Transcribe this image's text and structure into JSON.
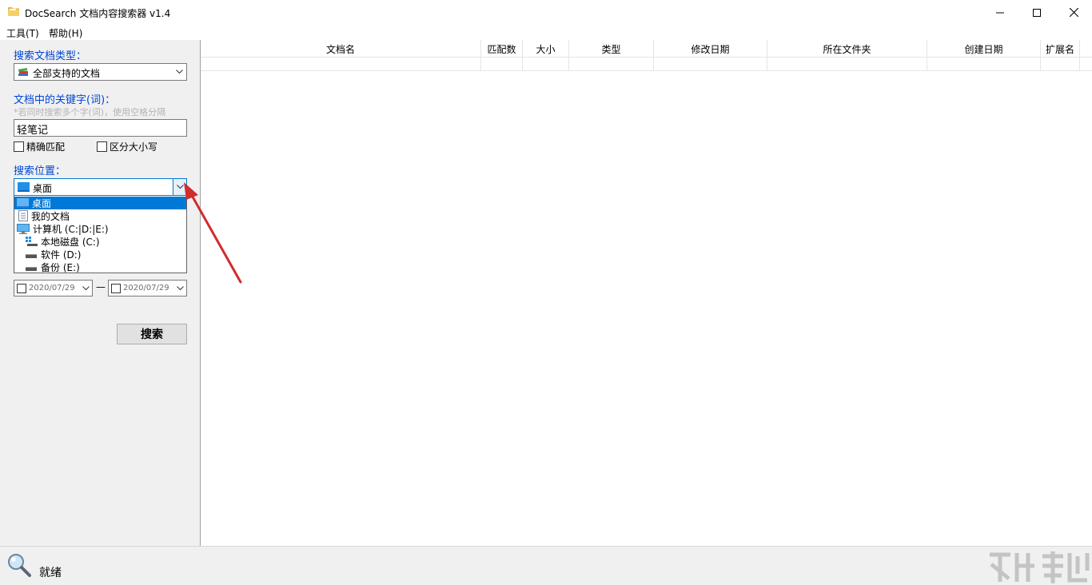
{
  "window": {
    "title": "DocSearch 文档内容搜索器 v1.4",
    "icon": "folder-icon"
  },
  "menu": {
    "tools": "工具(T)",
    "help": "帮助(H)"
  },
  "left_panel": {
    "doc_type_label": "搜索文档类型：",
    "doc_type_value": "全部支持的文档",
    "keyword_label": "文档中的关键字(词)：",
    "keyword_hint": "*若同时搜索多个字(词)，使用空格分隔",
    "keyword_value": "轻笔记",
    "exact_match": "精确匹配",
    "case_sensitive": "区分大小写",
    "location_label": "搜索位置：",
    "location_value": "桌面",
    "location_options": [
      {
        "label": "桌面",
        "icon": "desktop-icon",
        "selected": true
      },
      {
        "label": "我的文档",
        "icon": "document-icon",
        "selected": false
      },
      {
        "label": "计算机  (C:|D:|E:)",
        "icon": "computer-icon",
        "selected": false
      },
      {
        "label": "本地磁盘  (C:)",
        "icon": "drive-icon",
        "selected": false
      },
      {
        "label": "软件  (D:)",
        "icon": "drive-icon",
        "selected": false
      },
      {
        "label": "备份  (E:)",
        "icon": "drive-icon",
        "selected": false
      }
    ],
    "date_from": "2020/07/29",
    "date_to": "2020/07/29",
    "date_separator": "—",
    "search_button": "搜索"
  },
  "table": {
    "columns": [
      "文档名",
      "匹配数",
      "大小",
      "类型",
      "修改日期",
      "所在文件夹",
      "创建日期",
      "扩展名"
    ]
  },
  "status": {
    "text": "就绪",
    "icon": "magnifier-icon"
  },
  "annotation": {
    "color": "#d22b2b"
  }
}
